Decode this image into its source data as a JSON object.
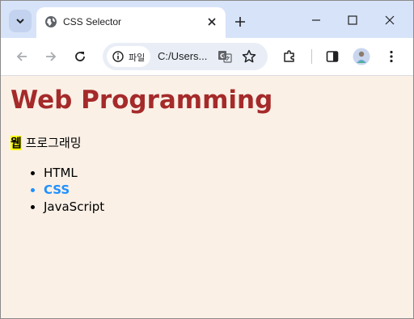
{
  "browser": {
    "tab_title": "CSS Selector",
    "site_chip_label": "파일",
    "url": "C:/Users...",
    "icons": {
      "tab_search": "chevron-down-icon",
      "favicon": "globe-icon",
      "tab_close": "close-icon",
      "new_tab": "plus-icon",
      "minimize": "minimize-icon",
      "maximize": "maximize-icon",
      "close_window": "close-icon",
      "back": "back-arrow-icon",
      "forward": "forward-arrow-icon",
      "reload": "reload-icon",
      "site_info": "info-icon",
      "translate": "translate-icon",
      "bookmark": "star-icon",
      "extensions": "puzzle-icon",
      "side_panel": "side-panel-icon",
      "profile": "avatar",
      "menu": "kebab-menu-icon"
    }
  },
  "page": {
    "heading": "Web Programming",
    "paragraph_highlight": "웹",
    "paragraph_rest": " 프로그래밍",
    "list_items": [
      "HTML",
      "CSS",
      "JavaScript"
    ],
    "colors": {
      "background": "#faf0e6",
      "heading": "#a52a2a",
      "highlight": "#ffff00",
      "active_item": "#1e90ff"
    }
  }
}
